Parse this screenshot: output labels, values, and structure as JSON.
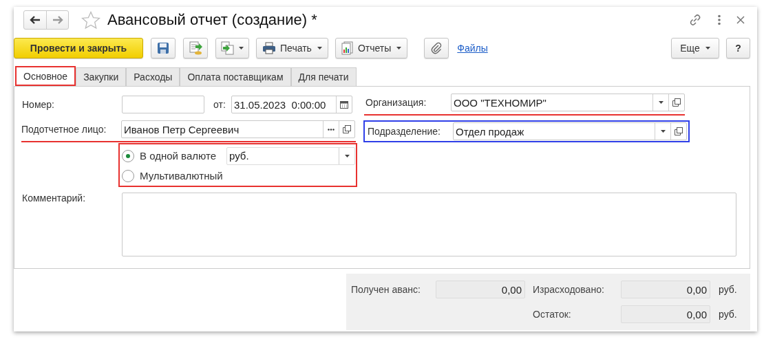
{
  "window": {
    "title": "Авансовый отчет (создание) *"
  },
  "toolbar": [
    {
      "kind": "primary",
      "label": "Провести и закрыть"
    },
    {
      "kind": "save"
    },
    {
      "kind": "post"
    },
    {
      "kind": "related",
      "dropdown": true
    },
    {
      "kind": "print",
      "label": "Печать",
      "dropdown": true
    },
    {
      "kind": "reports",
      "label": "Отчеты",
      "dropdown": true
    },
    {
      "kind": "attach"
    },
    {
      "kind": "link",
      "label": "Файлы"
    }
  ],
  "toolbar_right": [
    {
      "label": "Еще",
      "dropdown": true
    },
    {
      "label": "?",
      "dropdown": false
    }
  ],
  "tabs": [
    {
      "label": "Основное",
      "selected": true,
      "highlight": {
        "kind": "frame",
        "color": "#e8312f"
      }
    },
    {
      "label": "Закупки",
      "selected": false
    },
    {
      "label": "Расходы",
      "selected": false
    },
    {
      "label": "Оплата поставщикам",
      "selected": false
    },
    {
      "label": "Для печати",
      "selected": false
    }
  ],
  "number": {
    "label": "Номер:"
  },
  "date": {
    "label": "от:",
    "value": "31.05.2023  0:00:00"
  },
  "organization": {
    "label": "Организация:",
    "value": "ООО \"ТЕХНОМИР\"",
    "highlight": {
      "kind": "underline",
      "color": "#e8312f"
    }
  },
  "person": {
    "label": "Подотчетное лицо:",
    "value": "Иванов Петр Сергеевич",
    "highlight": {
      "kind": "underline",
      "color": "#e8312f"
    }
  },
  "department": {
    "label": "Подразделение:",
    "value": "Отдел продаж",
    "highlight": {
      "kind": "frame",
      "color": "#2f3fe8"
    }
  },
  "currency": {
    "options": [
      {
        "label": "В одной валюте",
        "selected": true
      },
      {
        "label": "Мультивалютный",
        "selected": false
      }
    ],
    "value": "руб.",
    "highlight": {
      "kind": "frame",
      "color": "#e8312f"
    }
  },
  "comment": {
    "label": "Комментарий:"
  },
  "totals": {
    "received": {
      "label": "Получен аванс:",
      "value": "0,00"
    },
    "spent": {
      "label": "Израсходовано:",
      "value": "0,00",
      "unit": "руб."
    },
    "balance": {
      "label": "Остаток:",
      "value": "0,00",
      "unit": "руб."
    }
  }
}
